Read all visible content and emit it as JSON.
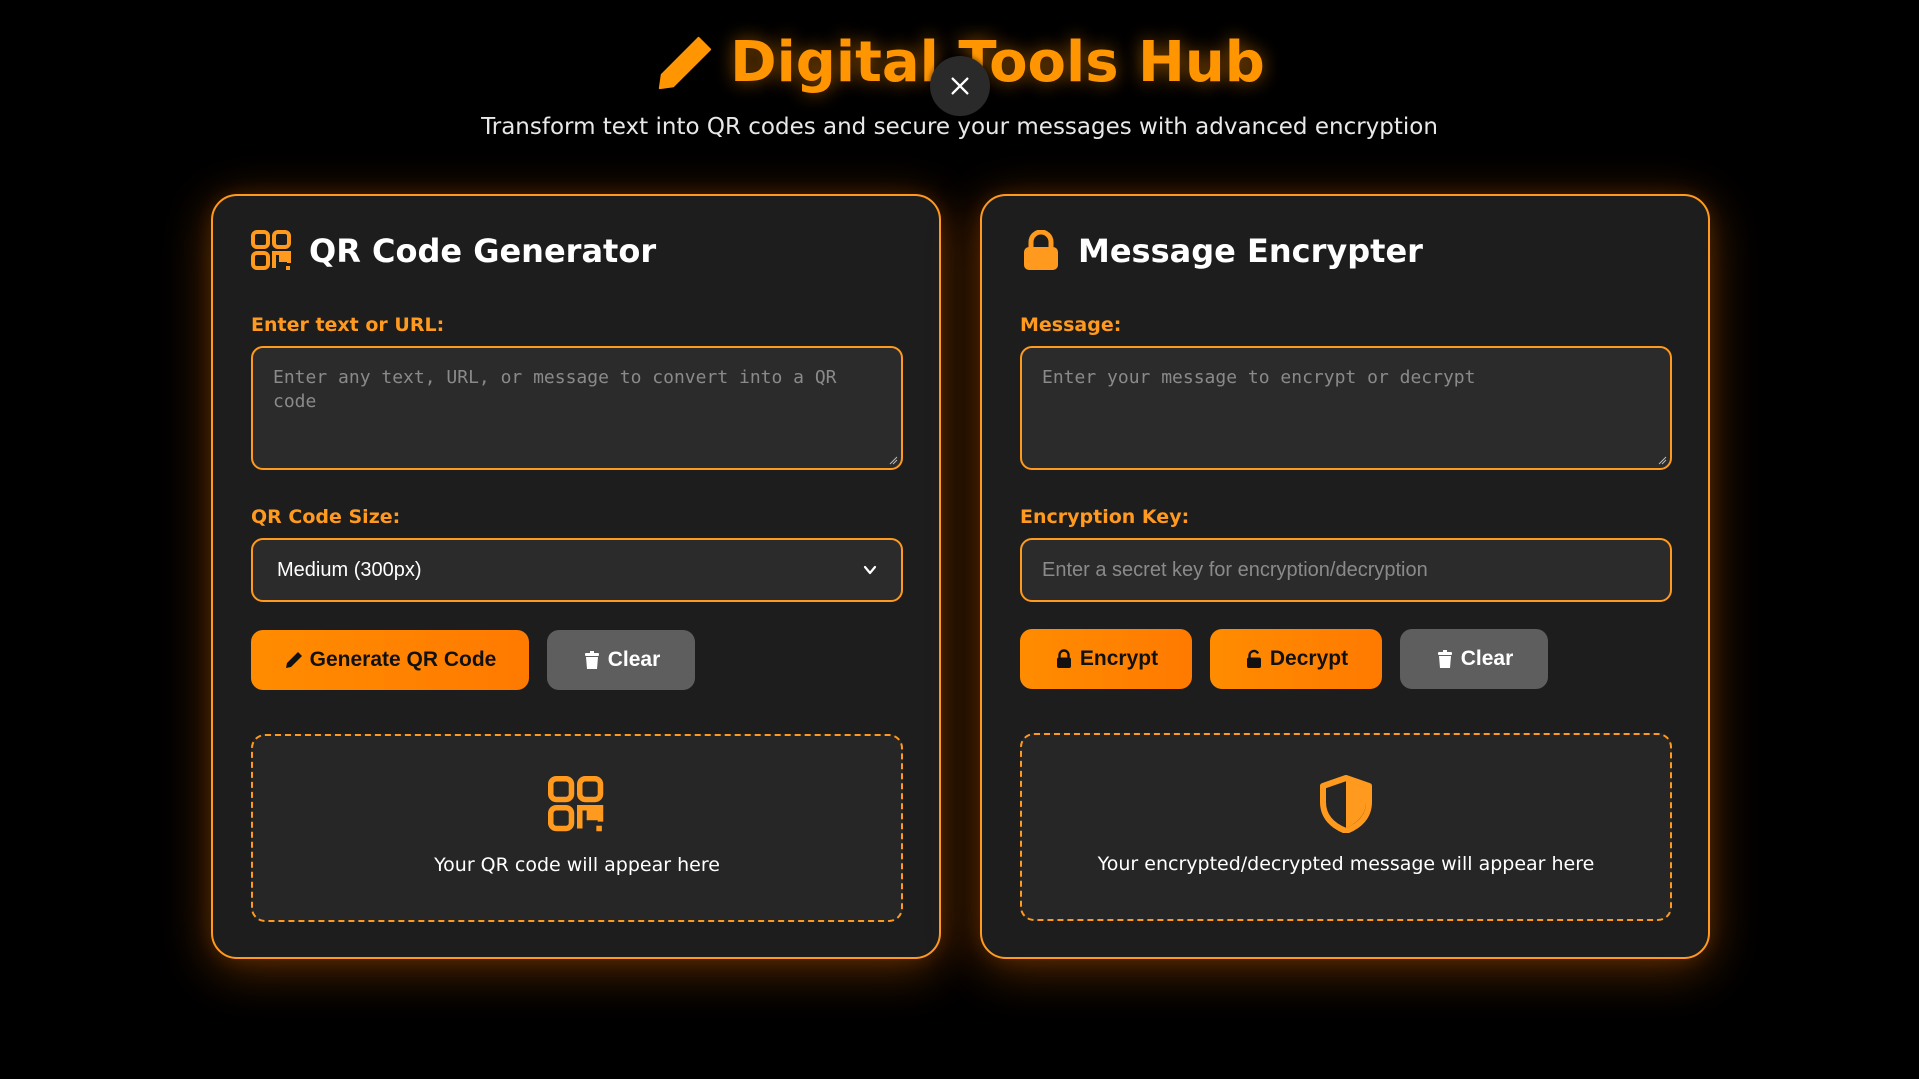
{
  "header": {
    "title": "Digital Tools Hub",
    "subtitle": "Transform text into QR codes and secure your messages with advanced encryption",
    "title_icon": "pencil-icon",
    "close_icon": "close-icon"
  },
  "colors": {
    "accent": "#ff9500",
    "background": "#000000",
    "card": "#1d1d1d",
    "field": "#2b2b2b",
    "gray_button": "#5e5e5e"
  },
  "qr_card": {
    "title": "QR Code Generator",
    "icon": "qrcode-icon",
    "text_label": "Enter text or URL:",
    "text_placeholder": "Enter any text, URL, or message to convert into a QR code",
    "size_label": "QR Code Size:",
    "size_selected": "Medium (300px)",
    "generate_label": "Generate QR Code",
    "clear_label": "Clear",
    "output_text": "Your QR code will appear here"
  },
  "encrypt_card": {
    "title": "Message Encrypter",
    "icon": "lock-icon",
    "message_label": "Message:",
    "message_placeholder": "Enter your message to encrypt or decrypt",
    "key_label": "Encryption Key:",
    "key_placeholder": "Enter a secret key for encryption/decryption",
    "encrypt_label": "Encrypt",
    "decrypt_label": "Decrypt",
    "clear_label": "Clear",
    "output_text": "Your encrypted/decrypted message will appear here"
  }
}
